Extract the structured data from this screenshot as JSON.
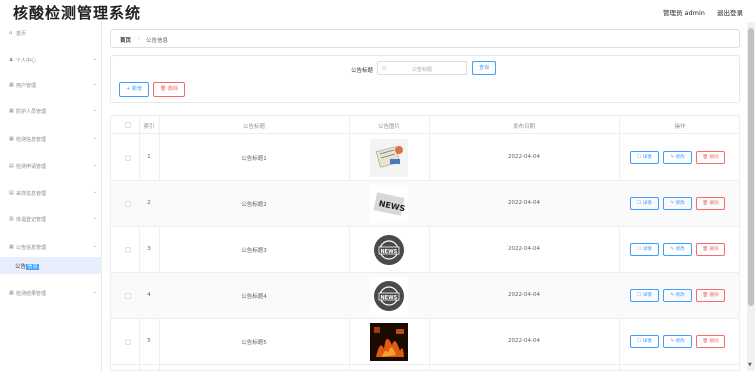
{
  "header": {
    "title": "核酸检测管理系统",
    "user": "管理员 admin",
    "logout": "退出登录"
  },
  "sidebar": {
    "items": [
      {
        "icon": "home-icon",
        "label": "首页",
        "glyph": "⌂"
      },
      {
        "icon": "user-icon",
        "label": "个人中心",
        "glyph": "♟"
      },
      {
        "icon": "grid-icon",
        "label": "用户管理",
        "glyph": "▦"
      },
      {
        "icon": "grid-icon",
        "label": "防护人员管理",
        "glyph": "▦"
      },
      {
        "icon": "grid-icon",
        "label": "检测信息管理",
        "glyph": "▦"
      },
      {
        "icon": "list-icon",
        "label": "检测申请管理",
        "glyph": "▤"
      },
      {
        "icon": "list-icon",
        "label": "采样信息管理",
        "glyph": "▤"
      },
      {
        "icon": "chart-icon",
        "label": "体温登记管理",
        "glyph": "▥"
      },
      {
        "icon": "grid-icon",
        "label": "公告信息管理",
        "glyph": "▦"
      },
      {
        "icon": "grid-icon",
        "label": "检测结果管理",
        "glyph": "▦"
      }
    ],
    "submenu_prefix": "公告",
    "submenu_highlight": "信息"
  },
  "breadcrumb": {
    "home": "首页",
    "sep": "/",
    "current": "公告信息"
  },
  "search": {
    "label": "公告标题",
    "placeholder": "公告标题",
    "query_btn": "查询",
    "add_btn": "+ 新增",
    "delete_btn": "删除"
  },
  "table": {
    "headers": {
      "index": "索引",
      "title": "公告标题",
      "image": "公告图片",
      "date": "发布日期",
      "ops": "操作"
    },
    "ops": {
      "detail": "详情",
      "edit": "修改",
      "delete": "删除"
    },
    "rows": [
      {
        "index": "1",
        "title": "公告标题1",
        "date": "2022-04-04",
        "image": "news-clipboard-image"
      },
      {
        "index": "2",
        "title": "公告标题2",
        "date": "2022-04-04",
        "image": "news-paper-image"
      },
      {
        "index": "3",
        "title": "公告标题3",
        "date": "2022-04-04",
        "image": "news-globe-image"
      },
      {
        "index": "4",
        "title": "公告标题4",
        "date": "2022-04-04",
        "image": "news-globe-image"
      },
      {
        "index": "5",
        "title": "公告标题5",
        "date": "2022-04-04",
        "image": "fire-image"
      }
    ]
  },
  "colors": {
    "primary": "#409eff",
    "danger": "#f56c6c",
    "row_alt": "#fafafa",
    "submenu_bg": "#e8eefb"
  }
}
